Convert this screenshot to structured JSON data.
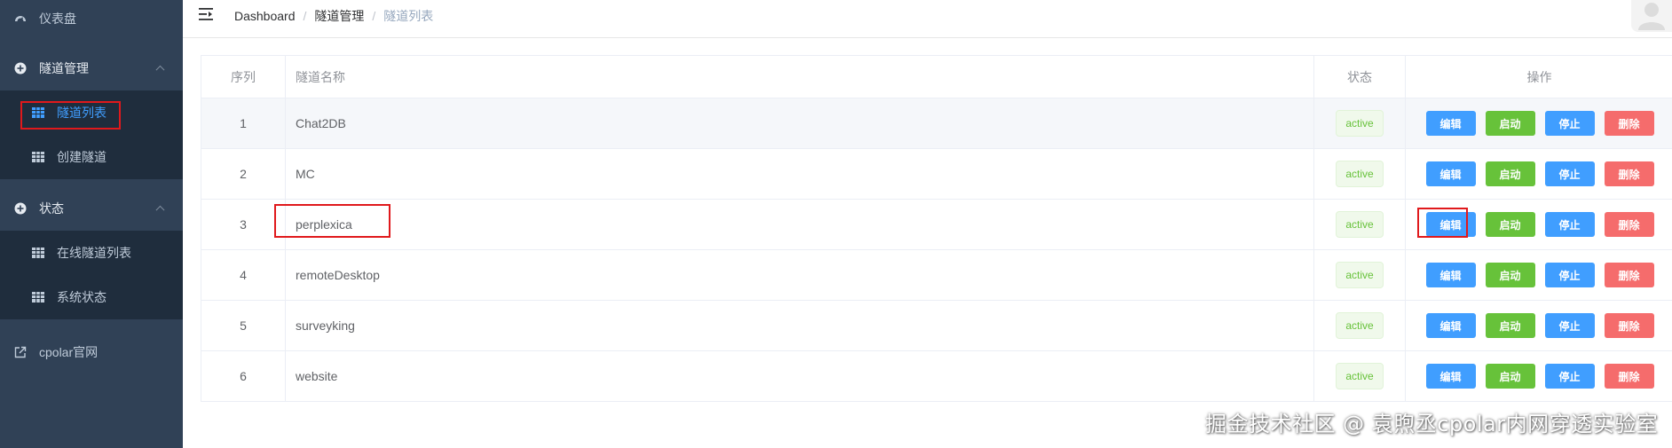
{
  "sidebar": {
    "dashboard": {
      "label": "仪表盘",
      "icon": "dashboard-icon"
    },
    "tunnel_mgmt": {
      "label": "隧道管理",
      "icon": "plus-circle-icon",
      "items": [
        {
          "label": "隧道列表",
          "icon": "table-icon",
          "active": true
        },
        {
          "label": "创建隧道",
          "icon": "table-icon"
        }
      ]
    },
    "status": {
      "label": "状态",
      "icon": "plus-circle-icon",
      "items": [
        {
          "label": "在线隧道列表",
          "icon": "table-icon"
        },
        {
          "label": "系统状态",
          "icon": "table-icon"
        }
      ]
    },
    "cpolar": {
      "label": "cpolar官网",
      "icon": "external-link-icon"
    }
  },
  "breadcrumb": {
    "home": "Dashboard",
    "section": "隧道管理",
    "current": "隧道列表",
    "separator": "/"
  },
  "table": {
    "headers": {
      "index": "序列",
      "name": "隧道名称",
      "status": "状态",
      "ops": "操作"
    },
    "rows": [
      {
        "index": "1",
        "name": "Chat2DB",
        "status": "active"
      },
      {
        "index": "2",
        "name": "MC",
        "status": "active"
      },
      {
        "index": "3",
        "name": "perplexica",
        "status": "active"
      },
      {
        "index": "4",
        "name": "remoteDesktop",
        "status": "active"
      },
      {
        "index": "5",
        "name": "surveyking",
        "status": "active"
      },
      {
        "index": "6",
        "name": "website",
        "status": "active"
      }
    ],
    "buttons": {
      "edit": "编辑",
      "start": "启动",
      "stop": "停止",
      "delete": "删除"
    }
  },
  "colors": {
    "sidebar_bg": "#304156",
    "submenu_bg": "#1f2d3d",
    "primary": "#409eff",
    "success": "#67c23a",
    "danger": "#f56c6c",
    "highlight": "#e0191c"
  },
  "watermark": "掘金技术社区 @ 袁煦丞cpolar内网穿透实验室"
}
